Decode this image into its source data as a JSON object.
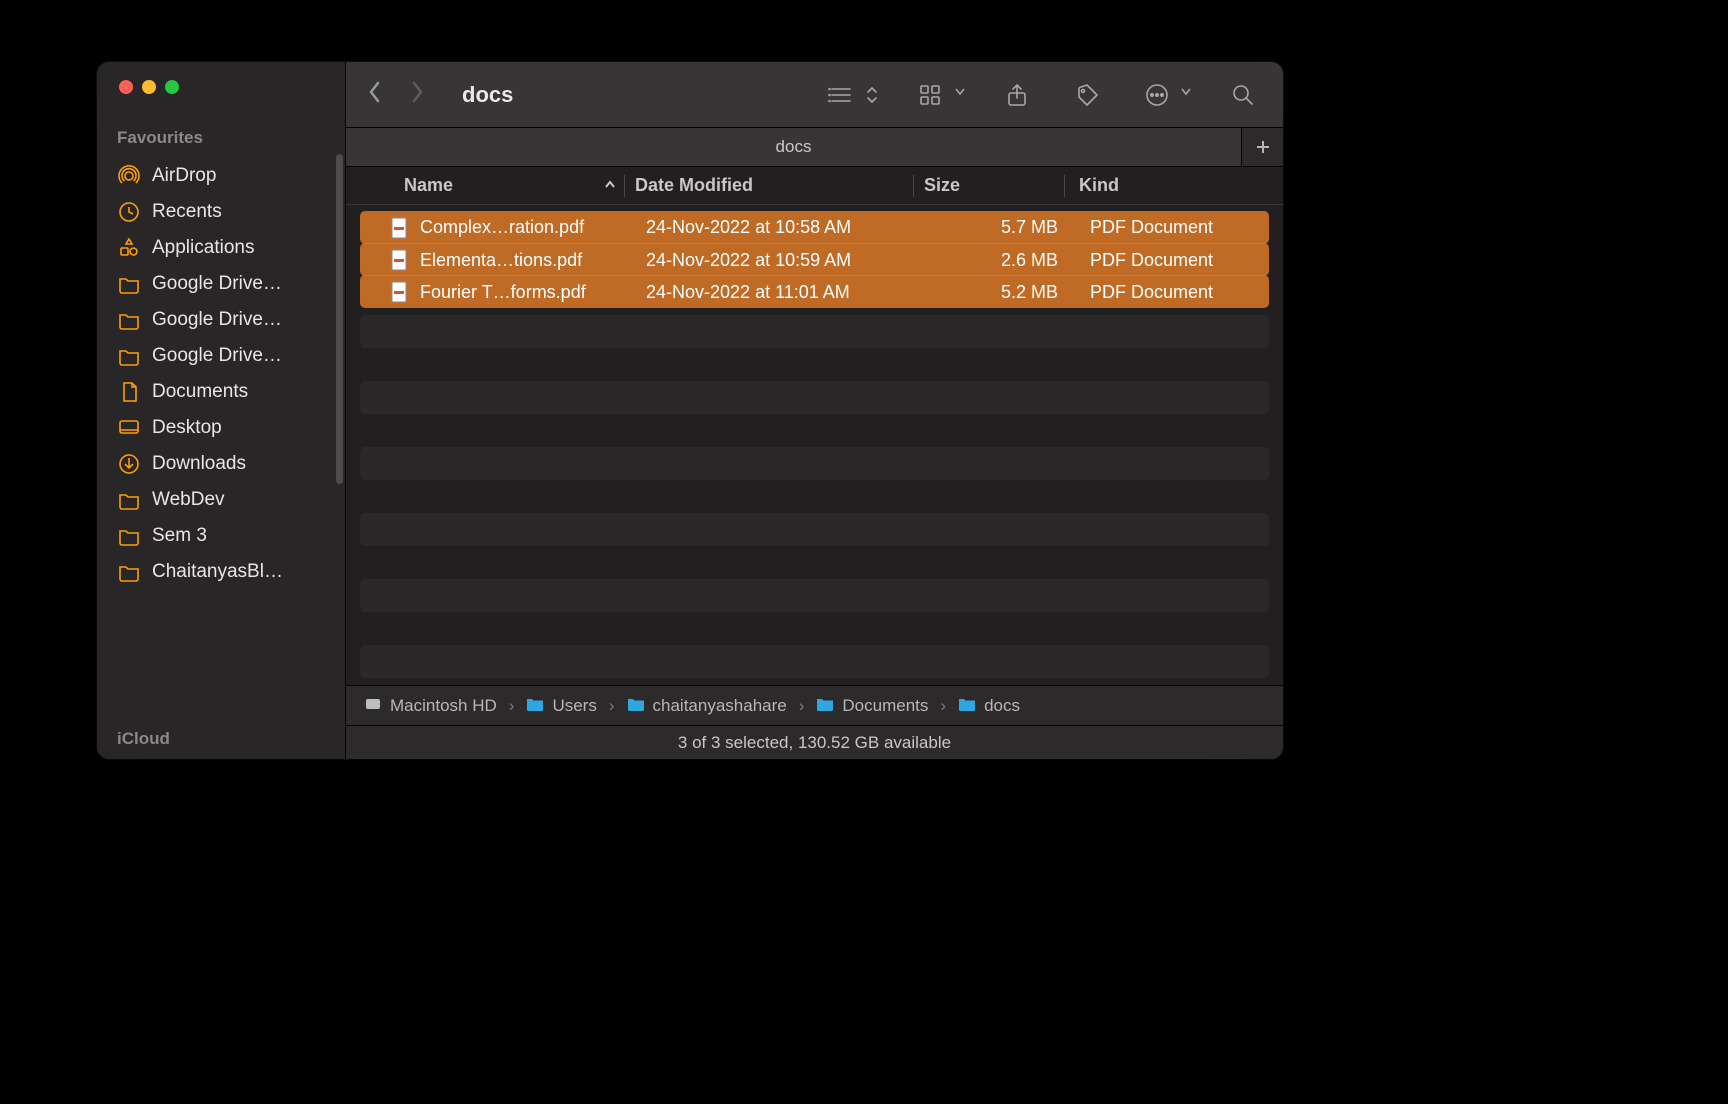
{
  "window_title": "docs",
  "sidebar": {
    "section_label": "Favourites",
    "icloud_label": "iCloud",
    "items": [
      {
        "label": "AirDrop",
        "icon": "airdrop-icon"
      },
      {
        "label": "Recents",
        "icon": "clock-icon"
      },
      {
        "label": "Applications",
        "icon": "apps-icon"
      },
      {
        "label": "Google Drive…",
        "icon": "folder-icon"
      },
      {
        "label": "Google Drive…",
        "icon": "folder-icon"
      },
      {
        "label": "Google Drive…",
        "icon": "folder-icon"
      },
      {
        "label": "Documents",
        "icon": "document-icon"
      },
      {
        "label": "Desktop",
        "icon": "desktop-icon"
      },
      {
        "label": "Downloads",
        "icon": "download-icon"
      },
      {
        "label": "WebDev",
        "icon": "folder-icon"
      },
      {
        "label": "Sem 3",
        "icon": "folder-icon"
      },
      {
        "label": "ChaitanyasBl…",
        "icon": "folder-icon"
      }
    ]
  },
  "tabbar": {
    "tabs": [
      {
        "label": "docs"
      }
    ]
  },
  "columns": {
    "name": "Name",
    "date": "Date Modified",
    "size": "Size",
    "kind": "Kind",
    "sort": "asc"
  },
  "files": [
    {
      "name": "Complex…ration.pdf",
      "date": "24-Nov-2022 at 10:58 AM",
      "size": "5.7 MB",
      "kind": "PDF Document",
      "selected": true
    },
    {
      "name": "Elementa…tions.pdf",
      "date": "24-Nov-2022 at 10:59 AM",
      "size": "2.6 MB",
      "kind": "PDF Document",
      "selected": true
    },
    {
      "name": "Fourier T…forms.pdf",
      "date": "24-Nov-2022 at 11:01 AM",
      "size": "5.2 MB",
      "kind": "PDF Document",
      "selected": true
    }
  ],
  "pathbar": [
    {
      "label": "Macintosh HD",
      "icon": "disk-icon"
    },
    {
      "label": "Users",
      "icon": "folder-blue-icon"
    },
    {
      "label": "chaitanyashahare",
      "icon": "folder-blue-icon"
    },
    {
      "label": "Documents",
      "icon": "folder-blue-icon"
    },
    {
      "label": "docs",
      "icon": "folder-blue-icon"
    }
  ],
  "statusbar": "3 of 3 selected, 130.52 GB available"
}
